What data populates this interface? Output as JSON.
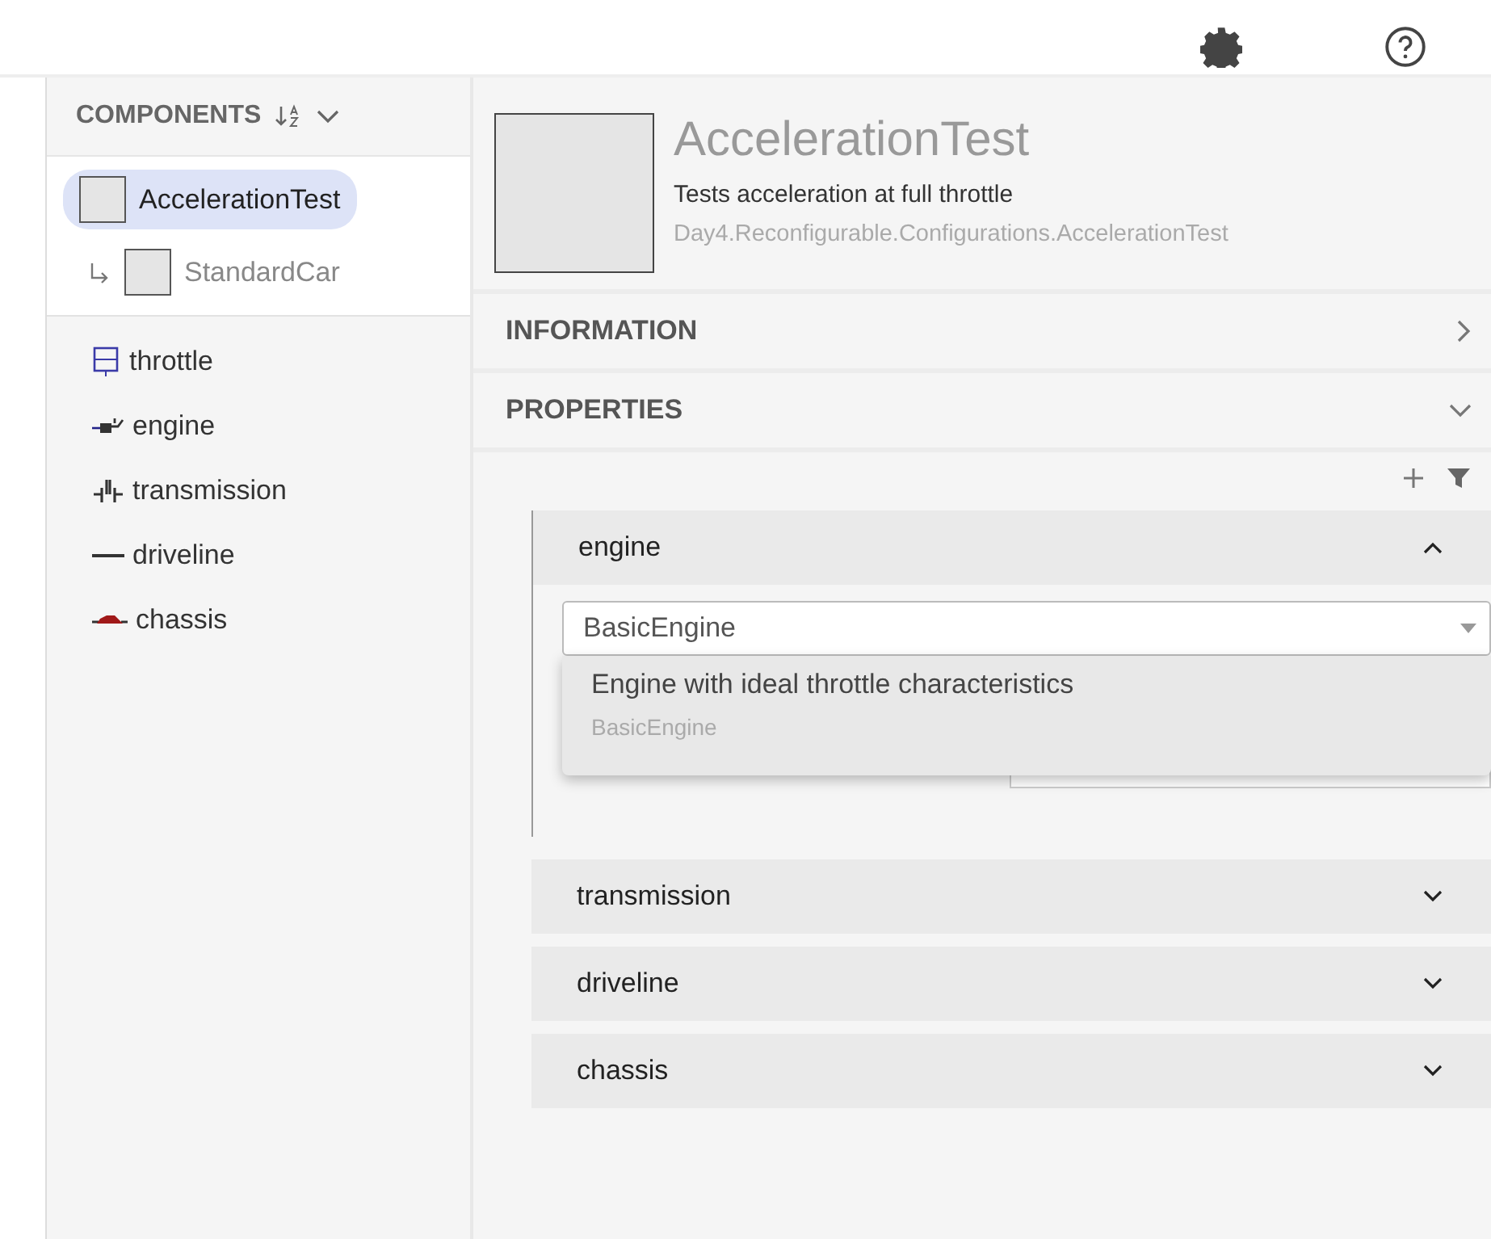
{
  "components_panel": {
    "title": "COMPONENTS",
    "tree": [
      {
        "label": "AccelerationTest",
        "selected": true,
        "children": [
          {
            "label": "StandardCar",
            "selected": false
          }
        ]
      }
    ],
    "items": [
      {
        "label": "throttle",
        "kind": "block"
      },
      {
        "label": "engine",
        "kind": "engine"
      },
      {
        "label": "transmission",
        "kind": "gear"
      },
      {
        "label": "driveline",
        "kind": "line"
      },
      {
        "label": "chassis",
        "kind": "car"
      }
    ]
  },
  "details": {
    "title": "AccelerationTest",
    "description": "Tests acceleration at full throttle",
    "path": "Day4.Reconfigurable.Configurations.AccelerationTest"
  },
  "sections": [
    {
      "label": "INFORMATION",
      "expanded": false
    },
    {
      "label": "PROPERTIES",
      "expanded": true
    }
  ],
  "property_groups": [
    {
      "label": "engine",
      "expanded": true,
      "value": "BasicEngine",
      "options": [
        {
          "description": "Engine with ideal throttle characteristics",
          "name": "BasicEngine"
        }
      ]
    },
    {
      "label": "transmission",
      "expanded": false
    },
    {
      "label": "driveline",
      "expanded": false
    },
    {
      "label": "chassis",
      "expanded": false
    }
  ]
}
